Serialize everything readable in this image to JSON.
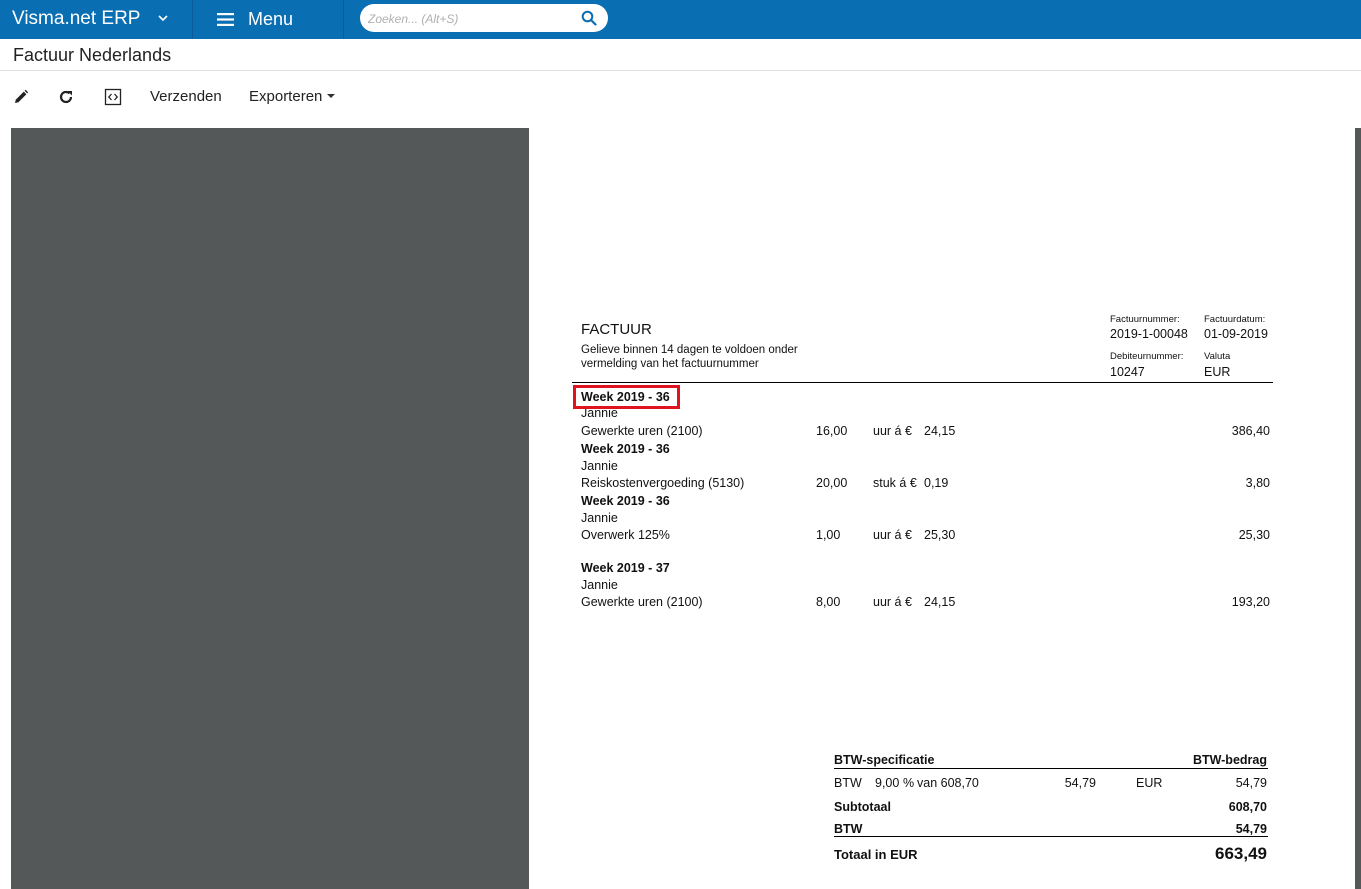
{
  "app": {
    "brand": "Visma.net ERP",
    "menu_label": "Menu",
    "search_placeholder": "Zoeken... (Alt+S)",
    "search_value": ""
  },
  "page": {
    "title": "Factuur Nederlands"
  },
  "toolbar": {
    "send_label": "Verzenden",
    "export_label": "Exporteren"
  },
  "invoice": {
    "title": "FACTUUR",
    "instruction_line1": "Gelieve binnen 14 dagen te voldoen onder",
    "instruction_line2": "vermelding van het factuurnummer",
    "meta": {
      "invoice_number_label": "Factuurnummer:",
      "invoice_number": "2019-1-00048",
      "invoice_date_label": "Factuurdatum:",
      "invoice_date": "01-09-2019",
      "debtor_number_label": "Debiteurnummer:",
      "debtor_number": "10247",
      "currency_label": "Valuta",
      "currency": "EUR"
    },
    "lines": [
      {
        "week": "Week 2019 - 36",
        "person": "Jannie",
        "description": "Gewerkte uren (2100)",
        "quantity": "16,00",
        "unit": "uur á €",
        "price": "24,15",
        "amount": "386,40"
      },
      {
        "week": "Week 2019 - 36",
        "person": "Jannie",
        "description": "Reiskostenvergoeding (5130)",
        "quantity": "20,00",
        "unit": "stuk á €",
        "price": "0,19",
        "amount": "3,80"
      },
      {
        "week": "Week 2019 - 36",
        "person": "Jannie",
        "description": "Overwerk 125%",
        "quantity": "1,00",
        "unit": "uur á €",
        "price": "25,30",
        "amount": "25,30"
      },
      {
        "week": "Week 2019 - 37",
        "person": "Jannie",
        "description": "Gewerkte uren (2100)",
        "quantity": "8,00",
        "unit": "uur á €",
        "price": "24,15",
        "amount": "193,20"
      }
    ],
    "vat": {
      "spec_header": "BTW-specificatie",
      "amount_header": "BTW-bedrag",
      "row_label": "BTW",
      "row_rate": "9,00",
      "row_pct": "%",
      "row_base": "van 608,70",
      "row_vat": "54,79",
      "row_currency": "EUR",
      "row_amount": "54,79",
      "subtotal_label": "Subtotaal",
      "subtotal": "608,70",
      "vat_label": "BTW",
      "vat_total": "54,79",
      "total_label": "Totaal in EUR",
      "total": "663,49"
    }
  },
  "colors": {
    "topbar": "#0a6eb3",
    "viewer_bg": "#555859",
    "highlight": "#e0141e"
  }
}
